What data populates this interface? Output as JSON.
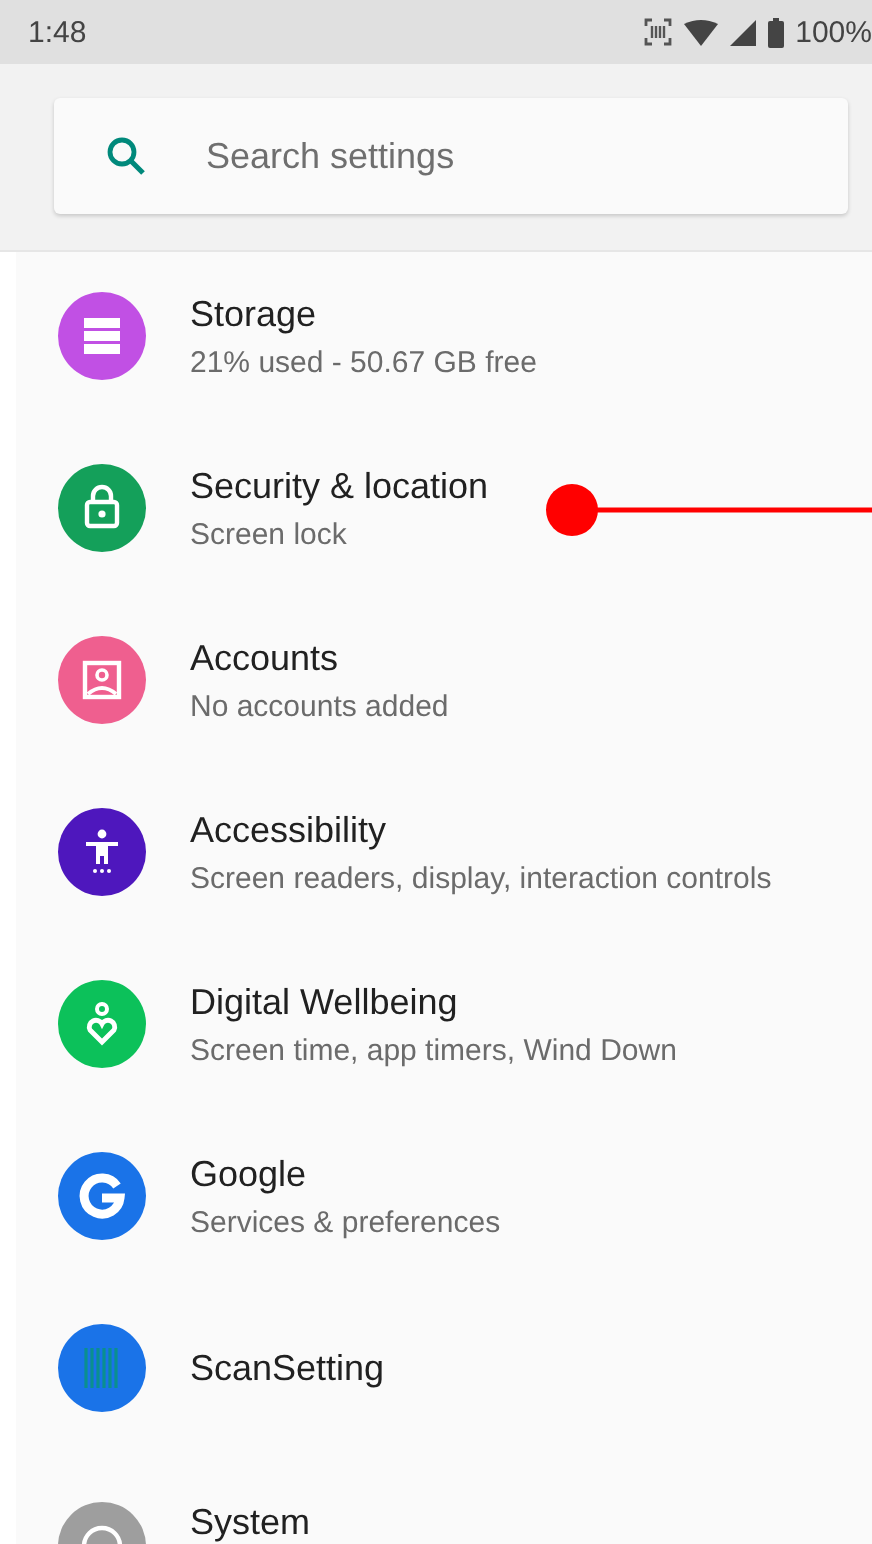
{
  "status_bar": {
    "time": "1:48",
    "battery": "100%"
  },
  "search": {
    "placeholder": "Search settings"
  },
  "items": [
    {
      "title": "Storage",
      "subtitle": "21% used - 50.67 GB free",
      "kind": "storage",
      "color": "#c150e4",
      "pointed": false
    },
    {
      "title": "Security & location",
      "subtitle": "Screen lock",
      "kind": "lock",
      "color": "#14a05a",
      "pointed": true
    },
    {
      "title": "Accounts",
      "subtitle": "No accounts added",
      "kind": "account",
      "color": "#ef5f8f",
      "pointed": false
    },
    {
      "title": "Accessibility",
      "subtitle": "Screen readers, display, interaction controls",
      "kind": "accessibility",
      "color": "#4e17bd",
      "pointed": false
    },
    {
      "title": "Digital Wellbeing",
      "subtitle": "Screen time, app timers, Wind Down",
      "kind": "wellbeing",
      "color": "#0cc15a",
      "pointed": false
    },
    {
      "title": "Google",
      "subtitle": "Services & preferences",
      "kind": "google",
      "color": "#1a73e8",
      "pointed": false
    },
    {
      "title": "ScanSetting",
      "kind": "barcode",
      "color": "#1a73e8",
      "pointed": false
    },
    {
      "title": "System",
      "kind": "system",
      "color": "#9e9e9e",
      "pointed": false
    }
  ]
}
